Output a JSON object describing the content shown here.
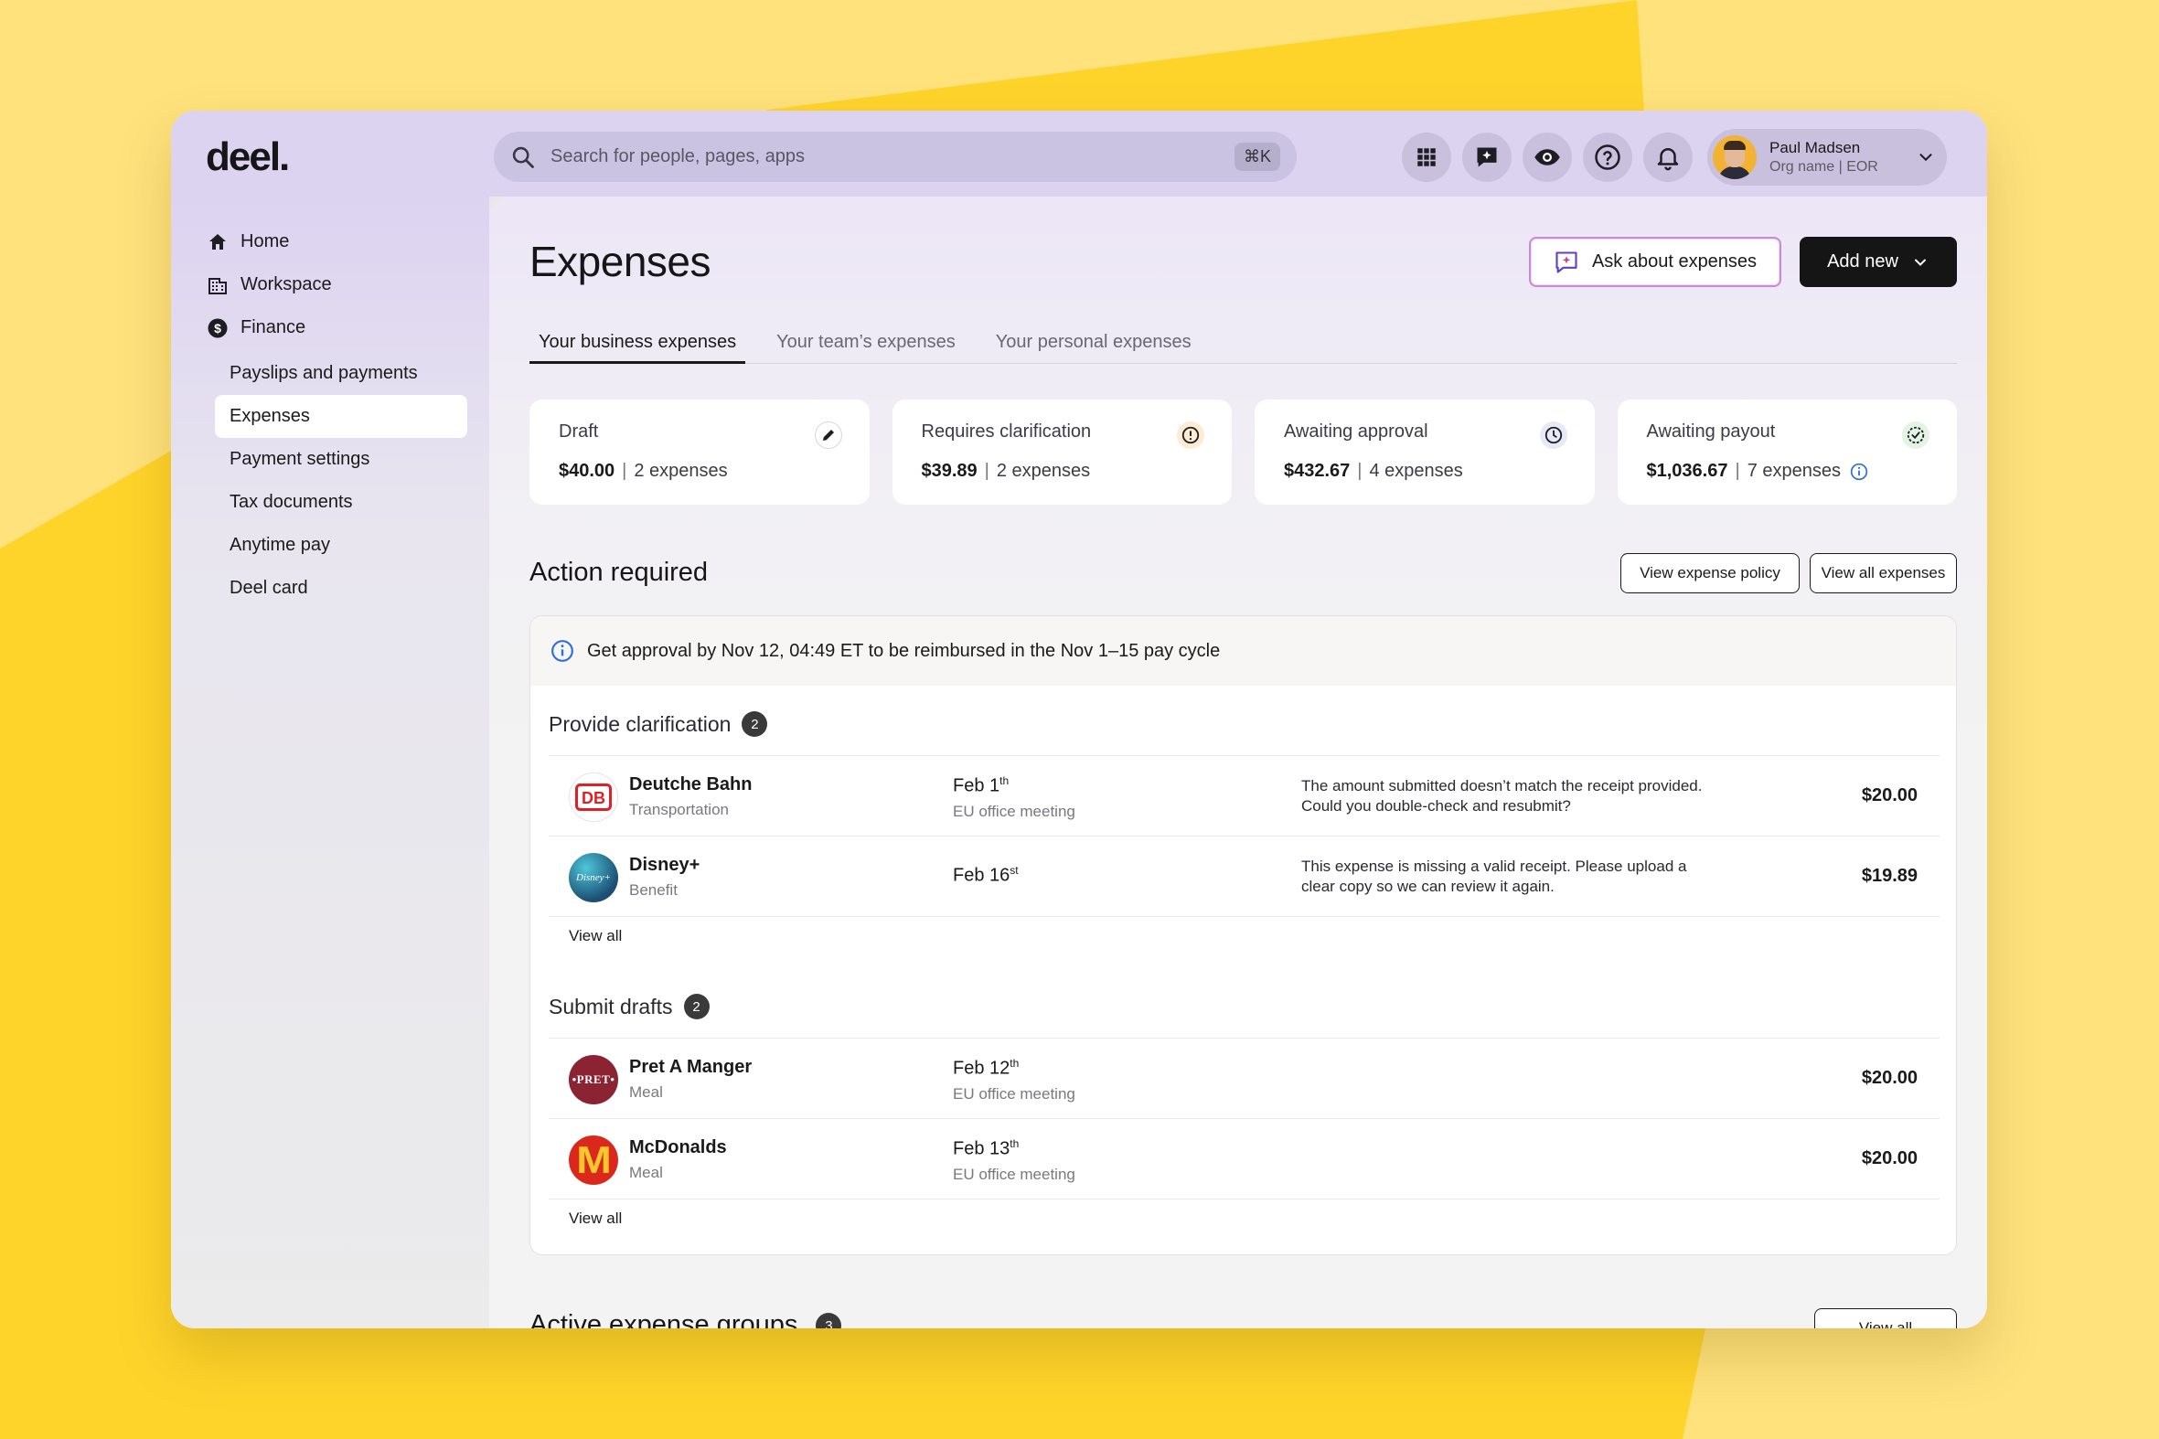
{
  "app": {
    "logo": "deel."
  },
  "search": {
    "placeholder": "Search for people, pages, apps",
    "shortcut": "⌘K"
  },
  "header_icons": [
    "apps-grid-icon",
    "ai-chat-icon",
    "eye-icon",
    "help-icon",
    "bell-icon"
  ],
  "user": {
    "name": "Paul Madsen",
    "org": "Org name | EOR"
  },
  "sidebar": {
    "items": [
      {
        "label": "Home",
        "icon": "home-icon"
      },
      {
        "label": "Workspace",
        "icon": "building-icon"
      },
      {
        "label": "Finance",
        "icon": "dollar-icon"
      }
    ],
    "finance_items": [
      "Payslips and payments",
      "Expenses",
      "Payment settings",
      "Tax documents",
      "Anytime pay",
      "Deel card"
    ],
    "active": "Expenses"
  },
  "page": {
    "title": "Expenses",
    "ask_label": "Ask about expenses",
    "add_new_label": "Add new"
  },
  "tabs": [
    "Your business expenses",
    "Your team’s expenses",
    "Your personal expenses"
  ],
  "summary_cards": [
    {
      "label": "Draft",
      "amount": "$40.00",
      "count": "2 expenses",
      "icon": "pencil-icon"
    },
    {
      "label": "Requires clarification",
      "amount": "$39.89",
      "count": "2 expenses",
      "icon": "alert-icon"
    },
    {
      "label": "Awaiting approval",
      "amount": "$432.67",
      "count": "4 expenses",
      "icon": "clock-icon"
    },
    {
      "label": "Awaiting payout",
      "amount": "$1,036.67",
      "count": "7 expenses",
      "icon": "check-badge-icon"
    }
  ],
  "action": {
    "title": "Action required",
    "policy_btn": "View expense policy",
    "all_btn": "View all expenses",
    "notice": "Get approval by Nov 12, 04:49 ET to be reimbursed in the Nov 1–15 pay cycle",
    "view_all": "View all"
  },
  "clarification": {
    "title": "Provide clarification",
    "count": "2",
    "rows": [
      {
        "merchant": "Deutche Bahn",
        "category": "Transportation",
        "date": "Feb 1",
        "date_suffix": "th",
        "event": "EU office meeting",
        "message": "The amount submitted doesn’t match the receipt provided. Could you double-check and resubmit?",
        "amount": "$20.00"
      },
      {
        "merchant": "Disney+",
        "category": "Benefit",
        "date": "Feb 16",
        "date_suffix": "st",
        "event": "",
        "message": "This expense is missing a valid receipt. Please upload a clear copy so we can review it again.",
        "amount": "$19.89"
      }
    ]
  },
  "drafts": {
    "title": "Submit drafts",
    "count": "2",
    "rows": [
      {
        "merchant": "Pret A Manger",
        "category": "Meal",
        "date": "Feb 12",
        "date_suffix": "th",
        "event": "EU office meeting",
        "message": "",
        "amount": "$20.00"
      },
      {
        "merchant": "McDonalds",
        "category": "Meal",
        "date": "Feb 13",
        "date_suffix": "th",
        "event": "EU office meeting",
        "message": "",
        "amount": "$20.00"
      }
    ]
  },
  "next_section": {
    "title": "Active expense groups",
    "count": "3",
    "button": "View all"
  },
  "logo_marks": {
    "db": "DB",
    "disney": "Disney+",
    "pret": "•PRET•",
    "mcd": "M"
  },
  "colors": {
    "brand_yellow": "#ffd42a",
    "header_purple": "#dcd3f1",
    "db_red": "#e31e24",
    "pret_red": "#8c2332",
    "mcd_red": "#da291c",
    "mcd_yellow": "#ffc72c"
  }
}
